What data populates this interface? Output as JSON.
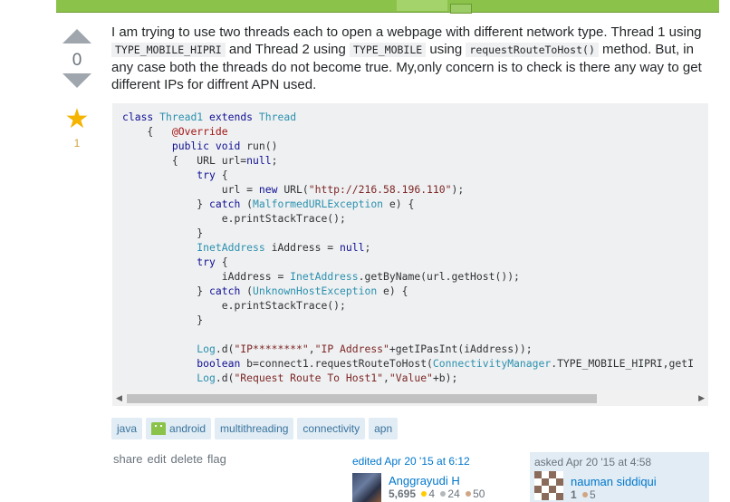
{
  "vote": {
    "count": "0",
    "favorite_count": "1"
  },
  "question": {
    "text_1": "I am trying to use two threads each to open a webpage with different network type. Thread 1 using ",
    "code_1": "TYPE_MOBILE_HIPRI",
    "text_2": " and Thread 2 using ",
    "code_2": "TYPE_MOBILE",
    "text_3": " using ",
    "code_3": "requestRouteToHost()",
    "text_4": " method. But, in any case both the threads do not become true. My,only concern is to check is there any way to get different IPs for diffrent APN used."
  },
  "code_lines": [
    [
      [
        "kw",
        "class "
      ],
      [
        "ty",
        "Thread1 "
      ],
      [
        "kw",
        "extends "
      ],
      [
        "ty",
        "Thread"
      ]
    ],
    [
      [
        "",
        "    {   "
      ],
      [
        "an",
        "@Override"
      ]
    ],
    [
      [
        "",
        "        "
      ],
      [
        "kw",
        "public void "
      ],
      [
        "",
        "run()"
      ]
    ],
    [
      [
        "",
        "        {   URL url="
      ],
      [
        "kw",
        "null"
      ],
      [
        "",
        ";"
      ]
    ],
    [
      [
        "",
        "            "
      ],
      [
        "kw",
        "try "
      ],
      [
        "",
        "{"
      ]
    ],
    [
      [
        "",
        "                url = "
      ],
      [
        "kw",
        "new "
      ],
      [
        "",
        "URL("
      ],
      [
        "st",
        "\"http://216.58.196.110\""
      ],
      [
        "",
        ");"
      ]
    ],
    [
      [
        "",
        "            } "
      ],
      [
        "kw",
        "catch "
      ],
      [
        "",
        "("
      ],
      [
        "ty",
        "MalformedURLException"
      ],
      [
        "",
        " e) {"
      ]
    ],
    [
      [
        "",
        "                e.printStackTrace();"
      ]
    ],
    [
      [
        "",
        "            }"
      ]
    ],
    [
      [
        "",
        "            "
      ],
      [
        "ty",
        "InetAddress"
      ],
      [
        "",
        " iAddress = "
      ],
      [
        "kw",
        "null"
      ],
      [
        "",
        ";"
      ]
    ],
    [
      [
        "",
        "            "
      ],
      [
        "kw",
        "try "
      ],
      [
        "",
        "{"
      ]
    ],
    [
      [
        "",
        "                iAddress = "
      ],
      [
        "ty",
        "InetAddress"
      ],
      [
        "",
        ".getByName(url.getHost());"
      ]
    ],
    [
      [
        "",
        "            } "
      ],
      [
        "kw",
        "catch "
      ],
      [
        "",
        "("
      ],
      [
        "ty",
        "UnknownHostException"
      ],
      [
        "",
        " e) {"
      ]
    ],
    [
      [
        "",
        "                e.printStackTrace();"
      ]
    ],
    [
      [
        "",
        "            }"
      ]
    ],
    [
      [
        "",
        ""
      ]
    ],
    [
      [
        "",
        "            "
      ],
      [
        "ty",
        "Log"
      ],
      [
        "",
        ".d("
      ],
      [
        "st",
        "\"IP********\""
      ],
      [
        "",
        ","
      ],
      [
        "st",
        "\"IP Address\""
      ],
      [
        "",
        "+getIPasInt(iAddress));"
      ]
    ],
    [
      [
        "",
        "            "
      ],
      [
        "kw",
        "boolean "
      ],
      [
        "",
        "b=connect1.requestRouteToHost("
      ],
      [
        "ty",
        "ConnectivityManager"
      ],
      [
        "",
        ".TYPE_MOBILE_HIPRI,getI"
      ]
    ],
    [
      [
        "",
        "            "
      ],
      [
        "ty",
        "Log"
      ],
      [
        "",
        ".d("
      ],
      [
        "st",
        "\"Request Route To Host1\""
      ],
      [
        "",
        ","
      ],
      [
        "st",
        "\"Value\""
      ],
      [
        "",
        "+b);"
      ]
    ]
  ],
  "tags": [
    "java",
    "android",
    "multithreading",
    "connectivity",
    "apn"
  ],
  "post_menu": {
    "share": "share",
    "edit": "edit",
    "delete": "delete",
    "flag": "flag"
  },
  "editor": {
    "action": "edited Apr 20 '15 at 6:12",
    "name": "Anggrayudi H",
    "rep": "5,695",
    "gold": "4",
    "silver": "24",
    "bronze": "50"
  },
  "owner": {
    "action": "asked Apr 20 '15 at 4:58",
    "name": "nauman siddiqui",
    "rep": "1",
    "bronze": "5"
  },
  "colors": {
    "gold": "#ffcc01",
    "silver": "#b4b8bc",
    "bronze": "#d1a684"
  }
}
